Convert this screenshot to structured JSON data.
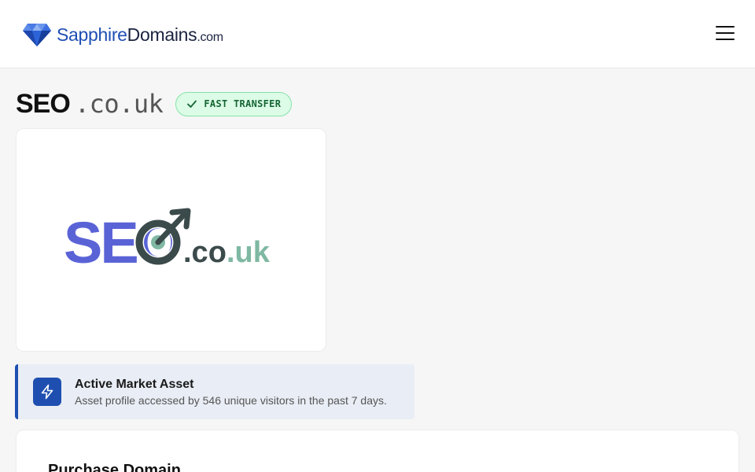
{
  "header": {
    "brand": {
      "part1": "Sapphire",
      "part2": "Domains",
      "part3": ".com",
      "icon": "diamond-icon"
    },
    "menu_icon": "hamburger-menu-icon"
  },
  "domain": {
    "name": "SEO",
    "tld": ".co.uk",
    "badge": "FAST TRANSFER",
    "badge_icon": "check-icon"
  },
  "logo": {
    "word": "SEO",
    "tld_part1": ".co",
    "tld_part2": ".uk"
  },
  "activity": {
    "title": "Active Market Asset",
    "text": "Asset profile accessed by 546 unique visitors in the past 7 days.",
    "icon": "lightning-bolt-icon"
  },
  "purchase": {
    "title": "Purchase Domain"
  },
  "colors": {
    "brand_blue": "#1f4fb4",
    "brand_dark": "#1b2340",
    "badge_green_bg": "#dcfce7",
    "badge_green_text": "#166534",
    "accent_blue": "#1e4fb0",
    "logo_indigo": "#5a63d6",
    "logo_slate": "#3b4a4a",
    "logo_teal": "#7fb8a3"
  }
}
